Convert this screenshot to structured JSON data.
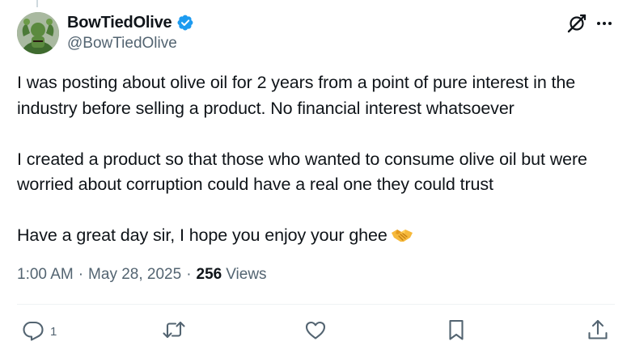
{
  "author": {
    "display_name": "BowTiedOlive",
    "handle": "@BowTiedOlive",
    "verified": true,
    "verified_color": "#1d9bf0"
  },
  "header_actions": {
    "grok_icon": "grok-icon",
    "more_icon": "more-icon"
  },
  "tweet": {
    "paragraphs": [
      "I was posting about olive oil for 2 years from a point of pure interest in the industry before selling a product. No financial interest whatsoever",
      "I created a product so that those who wanted to consume olive oil but were worried about corruption could have a real one they could trust",
      "Have a great day sir, I hope you enjoy your ghee"
    ],
    "trailing_emoji": "handshake-emoji"
  },
  "meta": {
    "time": "1:00 AM",
    "date": "May 28, 2025",
    "views_count": "256",
    "views_label": "Views",
    "separator": "·"
  },
  "actions": {
    "reply_count": "1",
    "retweet_count": "",
    "like_count": "",
    "bookmark_count": ""
  },
  "colors": {
    "text": "#0f1419",
    "secondary": "#536471",
    "divider": "#eff3f4"
  }
}
